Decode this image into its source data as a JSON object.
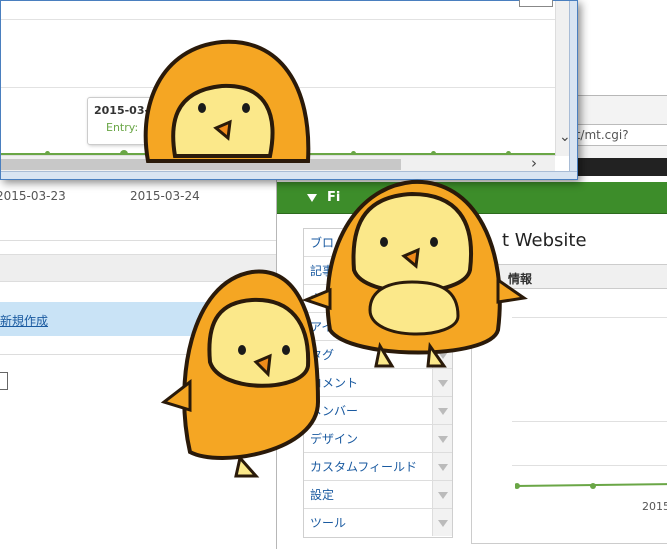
{
  "back_dashboard": {
    "date_ticks": [
      "2015-03-23",
      "2015-03-24"
    ],
    "create_link": "新規作成"
  },
  "window2": {
    "address": "mt/mt.cgi?",
    "address_icon": "search-icon",
    "section_title": "Fi",
    "site_title": "t Website",
    "panel_header": "情報",
    "x_tick": "2015-",
    "menu": [
      {
        "label": "ブロ"
      },
      {
        "label": "記事"
      },
      {
        "label": "ウ"
      },
      {
        "label": "アイテ"
      },
      {
        "label": "タグ"
      },
      {
        "label": "コメント"
      },
      {
        "label": "メンバー"
      },
      {
        "label": "デザイン"
      },
      {
        "label": "カスタムフィールド"
      },
      {
        "label": "設定"
      },
      {
        "label": "ツール"
      }
    ]
  },
  "window1": {
    "tooltip_date": "2015-03-",
    "tooltip_entry": "Entry:"
  },
  "colors": {
    "accent_green": "#3d8d2a",
    "chart_green": "#6aa646",
    "link_blue": "#1a5aa0",
    "chick_orange": "#f5a623",
    "chick_face": "#fbe88a"
  }
}
